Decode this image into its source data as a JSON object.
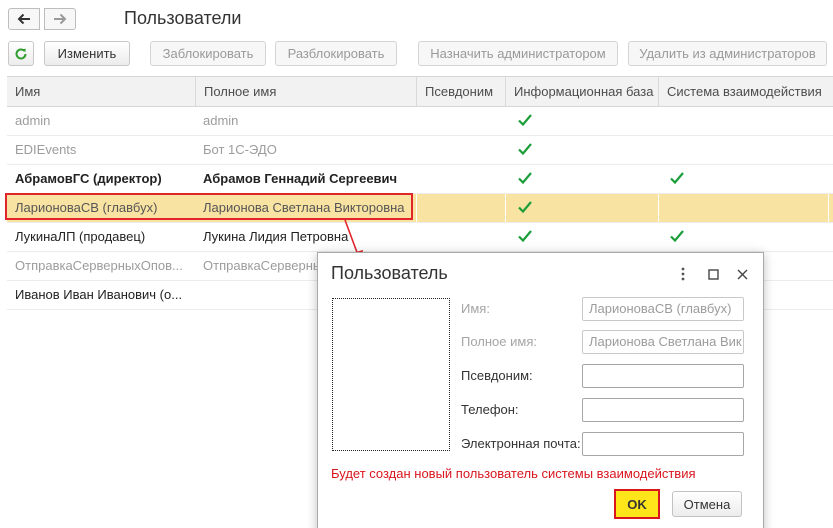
{
  "window": {
    "title": "Пользователи"
  },
  "toolbar": {
    "change_label": "Изменить",
    "block_label": "Заблокировать",
    "unblock_label": "Разблокировать",
    "assign_admin_label": "Назначить администратором",
    "remove_admin_label": "Удалить из администраторов"
  },
  "table": {
    "columns": [
      "Имя",
      "Полное имя",
      "Псевдоним",
      "Информационная база",
      "Система взаимодействия"
    ],
    "rows": [
      {
        "name": "admin",
        "full_name": "admin",
        "alias": "",
        "infobase": true,
        "interaction": false
      },
      {
        "name": "EDIEvents",
        "full_name": "Бот 1С-ЭДО",
        "alias": "",
        "infobase": true,
        "interaction": false
      },
      {
        "name": "АбрамовГС (директор)",
        "full_name": "Абрамов Геннадий Сергеевич",
        "alias": "",
        "infobase": true,
        "interaction": true
      },
      {
        "name": "ЛарионоваСВ (главбух)",
        "full_name": "Ларионова Светлана Викторовна",
        "alias": "",
        "infobase": true,
        "interaction": false
      },
      {
        "name": "ЛукинаЛП (продавец)",
        "full_name": "Лукина Лидия Петровна",
        "alias": "",
        "infobase": true,
        "interaction": true
      },
      {
        "name": "ОтправкаСерверныхОпов...",
        "full_name": "ОтправкаСерверны",
        "alias": "",
        "infobase": false,
        "interaction": false
      },
      {
        "name": "Иванов Иван Иванович (о...",
        "full_name": "",
        "alias": "",
        "infobase": false,
        "interaction": false
      }
    ]
  },
  "dialog": {
    "title": "Пользователь",
    "name_label": "Имя:",
    "name_value": "ЛарионоваСВ (главбух)",
    "full_name_label": "Полное имя:",
    "full_name_value": "Ларионова Светлана Вик",
    "alias_label": "Псевдоним:",
    "alias_value": "",
    "phone_label": "Телефон:",
    "phone_value": "",
    "email_label": "Электронная почта:",
    "email_value": "",
    "warning": "Будет создан новый пользователь системы взаимодействия",
    "ok_label": "OK",
    "cancel_label": "Отмена"
  },
  "colors": {
    "check": "#1b9e3a",
    "highlight": "#e0252b",
    "selected_row": "#f9e3a3",
    "ok_button": "#ffe61a"
  },
  "icons": [
    "back-arrow-icon",
    "forward-arrow-icon",
    "refresh-icon",
    "check-icon",
    "more-icon",
    "maximize-icon",
    "close-icon"
  ]
}
